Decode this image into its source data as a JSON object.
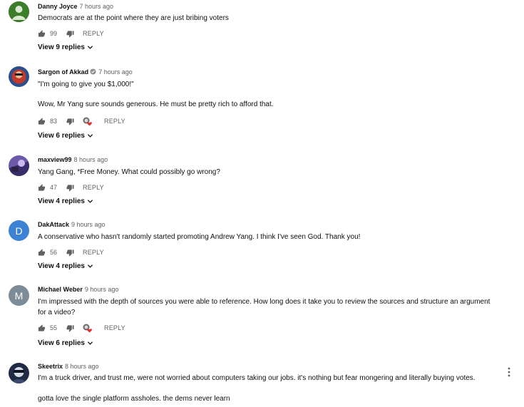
{
  "icons": {
    "like": "thumb-up-icon",
    "dislike": "thumb-down-icon",
    "chevron": "chevron-down-icon",
    "heart": "creator-heart-icon",
    "verified": "verified-check-icon",
    "more": "more-vert-icon"
  },
  "colors": {
    "heart": "#e52d27",
    "meta": "#606060",
    "text": "#0f0f0f"
  },
  "comments": [
    {
      "author": "Danny Joyce",
      "time": "7 hours ago",
      "text_lines": [
        "Democrats are at the point where they are just bribing voters"
      ],
      "likes": "99",
      "reply_label": "REPLY",
      "view_replies": "View 9 replies",
      "avatar_letter": ""
    },
    {
      "author": "Sargon of Akkad",
      "time": "7 hours ago",
      "text_lines": [
        "\"I'm going to give you $1,000!\"",
        "",
        "Wow, Mr Yang sure sounds generous. He must be pretty rich to afford that."
      ],
      "likes": "83",
      "reply_label": "REPLY",
      "view_replies": "View 6 replies",
      "avatar_letter": ""
    },
    {
      "author": "maxview99",
      "time": "8 hours ago",
      "text_lines": [
        "Yang Gang, *Free Money. What could possibly go wrong?"
      ],
      "likes": "47",
      "reply_label": "REPLY",
      "view_replies": "View 4 replies",
      "avatar_letter": ""
    },
    {
      "author": "DakAttack",
      "time": "9 hours ago",
      "text_lines": [
        "A conservative who hasn't randomly started promoting Andrew Yang. I think I've seen God. Thank you!"
      ],
      "likes": "56",
      "reply_label": "REPLY",
      "view_replies": "View 4 replies",
      "avatar_letter": "D"
    },
    {
      "author": "Michael Weber",
      "time": "9 hours ago",
      "text_lines": [
        "I'm impressed with the depth of sources you were able to reference. How long does it take you to review the sources and structure an argument",
        "for a video?"
      ],
      "likes": "55",
      "reply_label": "REPLY",
      "view_replies": "View 6 replies",
      "avatar_letter": "M"
    },
    {
      "author": "Skeetrix",
      "time": "8 hours ago",
      "text_lines": [
        "I'm a truck driver, and trust me, were not worried about computers taking our jobs. it's nothing but fear mongering and literally buying votes.",
        "",
        "gotta love the single platform assholes. the dems never learn"
      ],
      "likes": "",
      "reply_label": "",
      "view_replies": "",
      "avatar_letter": ""
    }
  ]
}
